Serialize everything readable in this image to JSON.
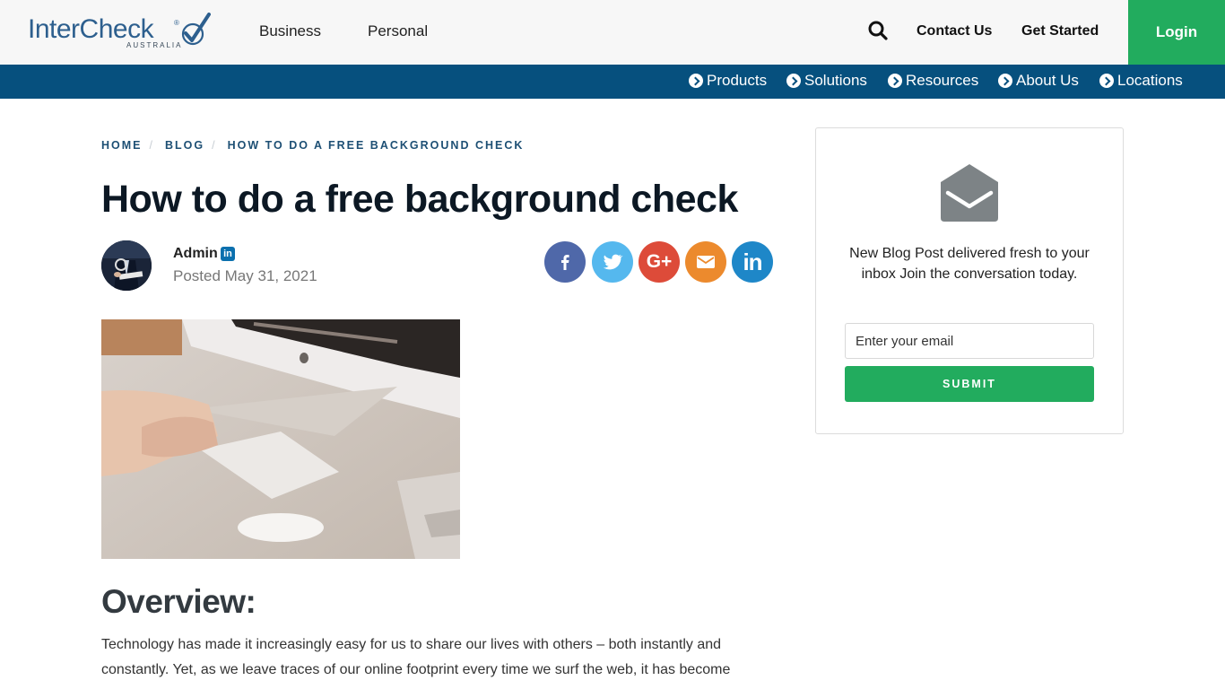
{
  "header": {
    "logo_text": "InterCheck",
    "logo_registered": "®",
    "logo_subtitle": "AUSTRALIA",
    "nav_primary": [
      {
        "label": "Business"
      },
      {
        "label": "Personal"
      }
    ],
    "search_icon": "search-icon",
    "contact_label": "Contact Us",
    "get_started_label": "Get Started",
    "login_label": "Login"
  },
  "subnav": {
    "items": [
      {
        "label": "Products",
        "icon": "chevron-circle-right-icon"
      },
      {
        "label": "Solutions",
        "icon": "chevron-circle-right-icon"
      },
      {
        "label": "Resources",
        "icon": "chevron-circle-right-icon"
      },
      {
        "label": "About Us",
        "icon": "chevron-circle-right-icon"
      },
      {
        "label": "Locations",
        "icon": "chevron-circle-right-icon"
      }
    ]
  },
  "breadcrumb": {
    "items": [
      "HOME",
      "BLOG",
      "HOW TO DO A FREE BACKGROUND CHECK"
    ],
    "separator": "/"
  },
  "article": {
    "title": "How to do a free background check",
    "author": "Admin",
    "author_linkedin_icon": "in",
    "posted": "Posted May 31, 2021",
    "share": [
      {
        "name": "facebook",
        "glyph": "f",
        "color": "#4f68a9"
      },
      {
        "name": "twitter",
        "glyph": "twitter",
        "color": "#55b8ee"
      },
      {
        "name": "google-plus",
        "glyph": "G+",
        "color": "#dd4b39"
      },
      {
        "name": "email",
        "glyph": "email",
        "color": "#ec8a2d"
      },
      {
        "name": "linkedin",
        "glyph": "in",
        "color": "#1e87c8"
      }
    ],
    "overview_heading": "Overview:",
    "paragraph": "Technology has made it increasingly easy for us to share our lives with others – both instantly and constantly. Yet, as we leave traces of our online footprint every time we surf the web, it has become"
  },
  "sidebar": {
    "text": "New Blog Post delivered fresh to your inbox Join the conversation today.",
    "email_placeholder": "Enter your email",
    "submit_label": "SUBMIT"
  },
  "colors": {
    "brand_blue": "#06507e",
    "brand_green": "#22ac5e",
    "topbar_bg": "#f7f7f7"
  }
}
